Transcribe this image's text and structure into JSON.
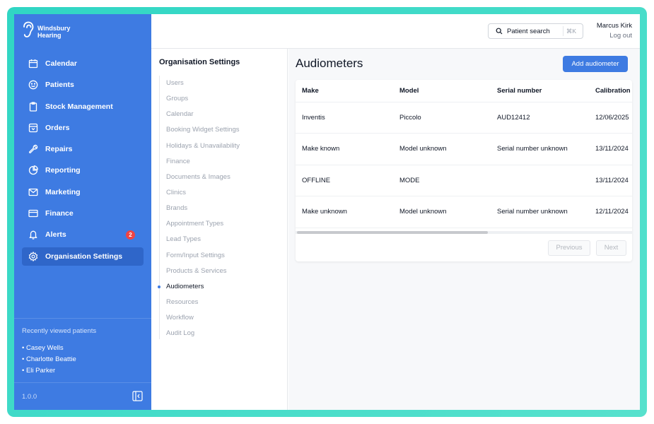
{
  "brand": {
    "name_line1": "Windsbury",
    "name_line2": "Hearing"
  },
  "sidebar": {
    "items": [
      {
        "label": "Calendar",
        "icon": "calendar-icon"
      },
      {
        "label": "Patients",
        "icon": "smiley-icon"
      },
      {
        "label": "Stock Management",
        "icon": "clipboard-icon"
      },
      {
        "label": "Orders",
        "icon": "box-icon"
      },
      {
        "label": "Repairs",
        "icon": "wrench-icon"
      },
      {
        "label": "Reporting",
        "icon": "pie-chart-icon"
      },
      {
        "label": "Marketing",
        "icon": "envelope-icon"
      },
      {
        "label": "Finance",
        "icon": "card-icon"
      },
      {
        "label": "Alerts",
        "icon": "bell-icon",
        "badge": "2"
      },
      {
        "label": "Organisation Settings",
        "icon": "gear-icon",
        "active": true
      }
    ],
    "recent_title": "Recently viewed patients",
    "recent_patients": [
      "• Casey Wells",
      "• Charlotte Beattie",
      "• Eli Parker"
    ],
    "version": "1.0.0"
  },
  "topbar": {
    "search_label": "Patient search",
    "search_shortcut": "⌘K",
    "user_name": "Marcus Kirk",
    "logout_label": "Log out"
  },
  "settings": {
    "title": "Organisation Settings",
    "items": [
      "Users",
      "Groups",
      "Calendar",
      "Booking Widget Settings",
      "Holidays & Unavailability",
      "Finance",
      "Documents & Images",
      "Clinics",
      "Brands",
      "Appointment Types",
      "Lead Types",
      "Form/Input Settings",
      "Products & Services",
      "Audiometers",
      "Resources",
      "Workflow",
      "Audit Log"
    ],
    "active_item": "Audiometers"
  },
  "main": {
    "title": "Audiometers",
    "add_button": "Add audiometer",
    "table": {
      "columns": [
        "Make",
        "Model",
        "Serial number",
        "Calibration"
      ],
      "rows": [
        [
          "Inventis",
          "Piccolo",
          "AUD12412",
          "12/06/2025"
        ],
        [
          "Make known",
          "Model unknown",
          "Serial number unknown",
          "13/11/2024"
        ],
        [
          "OFFLINE",
          "MODE",
          "",
          "13/11/2024"
        ],
        [
          "Make unknown",
          "Model unknown",
          "Serial number unknown",
          "12/11/2024"
        ]
      ]
    },
    "pagination": {
      "previous": "Previous",
      "next": "Next"
    }
  },
  "colors": {
    "accent": "#3e7be2",
    "frame": "#30d6c4",
    "alert": "#ef4444"
  }
}
